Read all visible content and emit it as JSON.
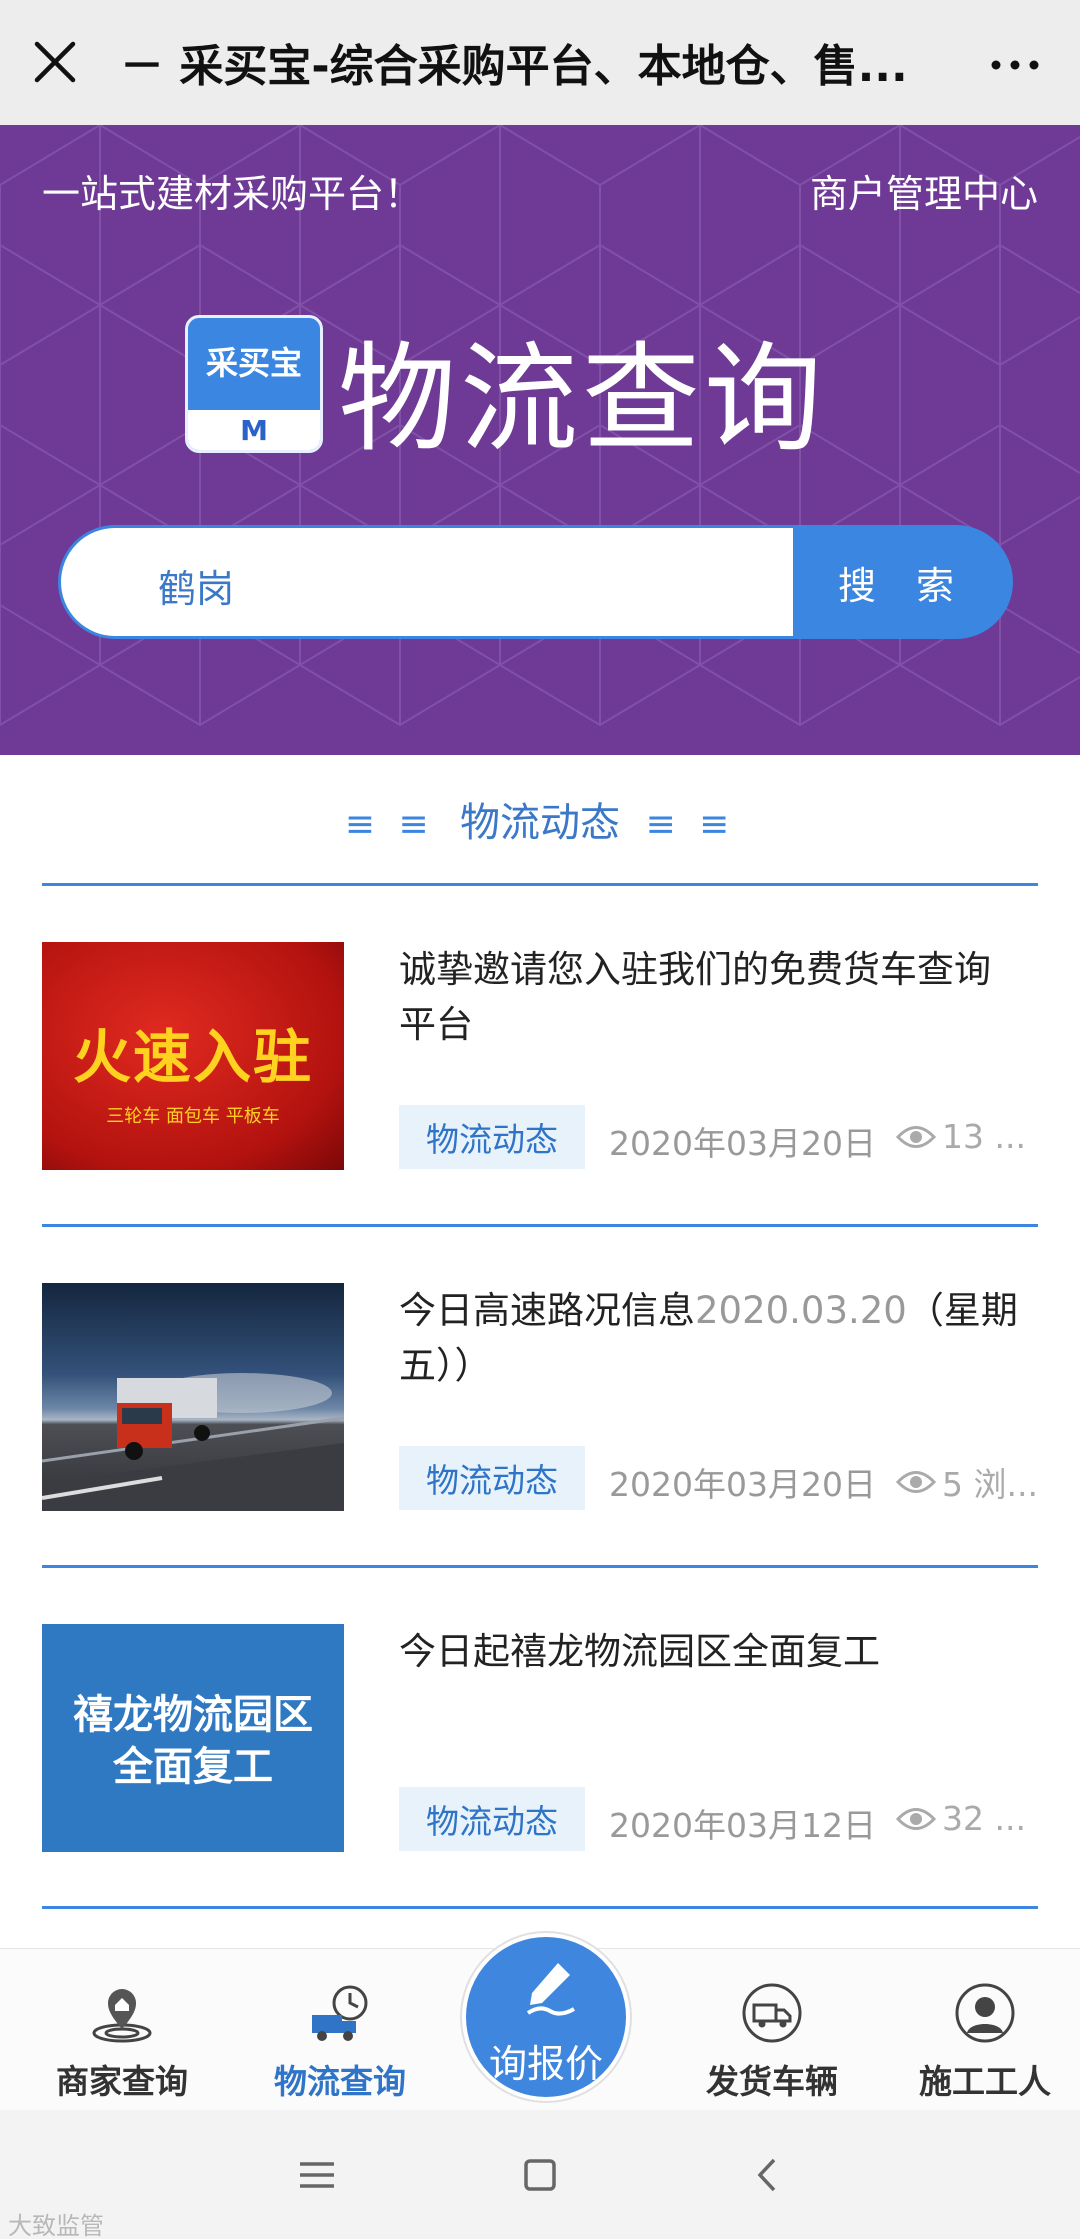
{
  "topbar": {
    "title": "－ 采买宝-综合采购平台、本地仓、售..."
  },
  "hero": {
    "tagline": "一站式建材采购平台！",
    "merchant_link": "商户管理中心",
    "logo_text": "采买宝",
    "logo_mark": "M",
    "headline": "物流查询",
    "search_value": "鹤岗",
    "search_button": "搜 索"
  },
  "section": {
    "title": "物流动态",
    "bars_left": "≡ ≡",
    "bars_right": "≡ ≡"
  },
  "articles": [
    {
      "title": "诚挚邀请您入驻我们的免费货车查询平台",
      "title_light": "",
      "title_tail": "",
      "tag": "物流动态",
      "date": "2020年03月20日",
      "views": "13 ...",
      "thumb_big": "火速入驻",
      "thumb_small": "三轮车 面包车 平板车"
    },
    {
      "title": "今日高速路况信息",
      "title_light": "2020.03.20",
      "title_tail": "（星期五））",
      "tag": "物流动态",
      "date": "2020年03月20日",
      "views": "5 浏..."
    },
    {
      "title": "今日起禧龙物流园区全面复工",
      "title_light": "",
      "title_tail": "",
      "tag": "物流动态",
      "date": "2020年03月12日",
      "views": "32 ...",
      "thumb_line1": "禧龙物流园区",
      "thumb_line2": "全面复工"
    }
  ],
  "tabbar": {
    "tabs": [
      {
        "label": "商家查询",
        "icon": "map-pin-icon",
        "active": false
      },
      {
        "label": "物流查询",
        "icon": "delivery-truck-clock-icon",
        "active": true
      },
      {
        "label": "发货车辆",
        "icon": "truck-circle-icon",
        "active": false
      },
      {
        "label": "施工工人",
        "icon": "worker-avatar-icon",
        "active": false
      }
    ],
    "center_label": "询报价"
  },
  "watermark": "大致监管",
  "colors": {
    "hero_bg": "#6e3a96",
    "accent": "#3b86e0",
    "tag_bg": "#e7f2fb"
  }
}
